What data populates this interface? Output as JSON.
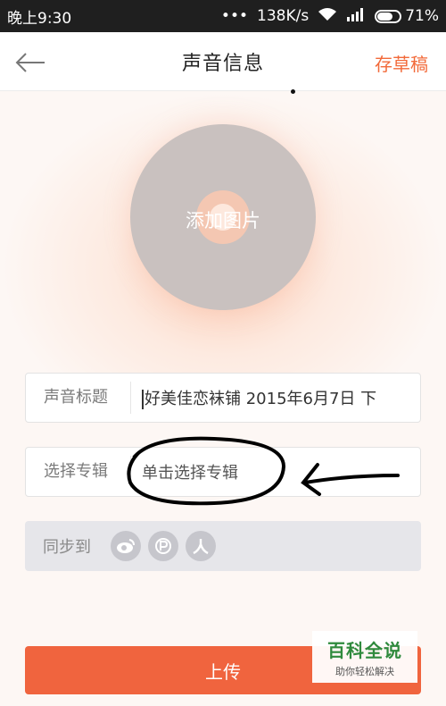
{
  "status_bar": {
    "time": "晚上9:30",
    "network_speed": "138K/s",
    "battery_percent": "71%",
    "battery_level": 0.71
  },
  "header": {
    "title": "声音信息",
    "save_draft_label": "存草稿"
  },
  "cover": {
    "add_image_label": "添加图片"
  },
  "form": {
    "title_label": "声音标题",
    "title_value": "好美佳恋袜铺 2015年6月7日 下",
    "album_label": "选择专辑",
    "album_placeholder": "单击选择专辑",
    "sync_label": "同步到",
    "sync_icons": [
      "weibo-icon",
      "podcast-icon",
      "renren-icon"
    ]
  },
  "upload_label": "上传",
  "watermark": {
    "title": "百科全说",
    "subtitle": "助你轻松解决"
  },
  "colors": {
    "accent": "#f0643e",
    "draft": "#f26a3a"
  }
}
